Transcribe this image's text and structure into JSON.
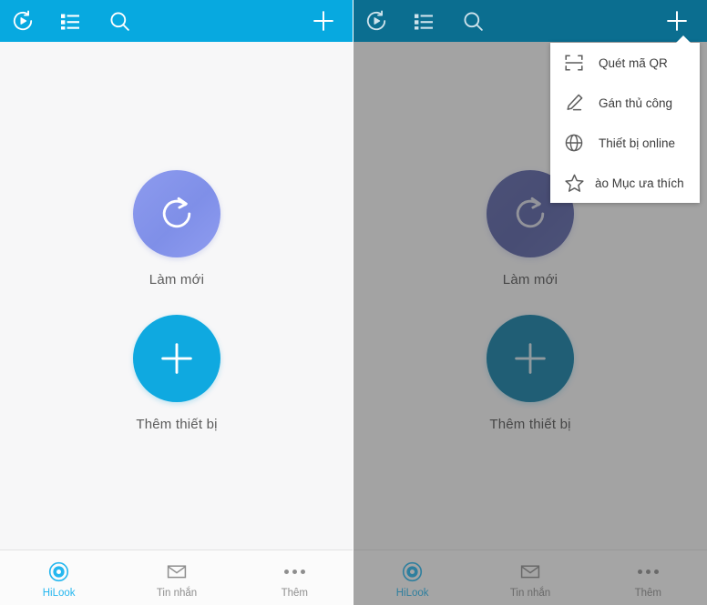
{
  "app": {
    "accent_blue": "#07a9e0",
    "accent_blue_dim": "#0b6e90",
    "refresh_purple": "#8d9bee",
    "add_blue": "#0fa9e0",
    "dim_overlay": "#979797",
    "background": "#f7f7f8"
  },
  "appbar": {
    "icons": [
      {
        "name": "history-playback-icon",
        "label": "Phát lại"
      },
      {
        "name": "device-list-icon",
        "label": "Danh sách"
      },
      {
        "name": "search-icon",
        "label": "Tìm kiếm"
      },
      {
        "name": "add-icon",
        "label": "Thêm"
      }
    ]
  },
  "content": {
    "refresh": {
      "label": "Làm mới",
      "icon": "refresh-icon"
    },
    "add_device": {
      "label": "Thêm thiết bị",
      "icon": "plus-icon"
    }
  },
  "tabbar": {
    "tabs": [
      {
        "label": "HiLook",
        "icon": "hilook-lens-icon",
        "active": true
      },
      {
        "label": "Tin nhắn",
        "icon": "envelope-icon",
        "active": false
      },
      {
        "label": "Thêm",
        "icon": "more-dots-icon",
        "active": false
      }
    ]
  },
  "popup_menu": {
    "items": [
      {
        "label": "Quét mã QR",
        "icon": "qr-scan-icon"
      },
      {
        "label": "Gán thủ công",
        "icon": "pencil-edit-icon"
      },
      {
        "label": "Thiết bị online",
        "icon": "globe-icon"
      },
      {
        "label": "Vào Mục ưa thích",
        "icon": "star-icon",
        "clipped": true
      }
    ]
  }
}
